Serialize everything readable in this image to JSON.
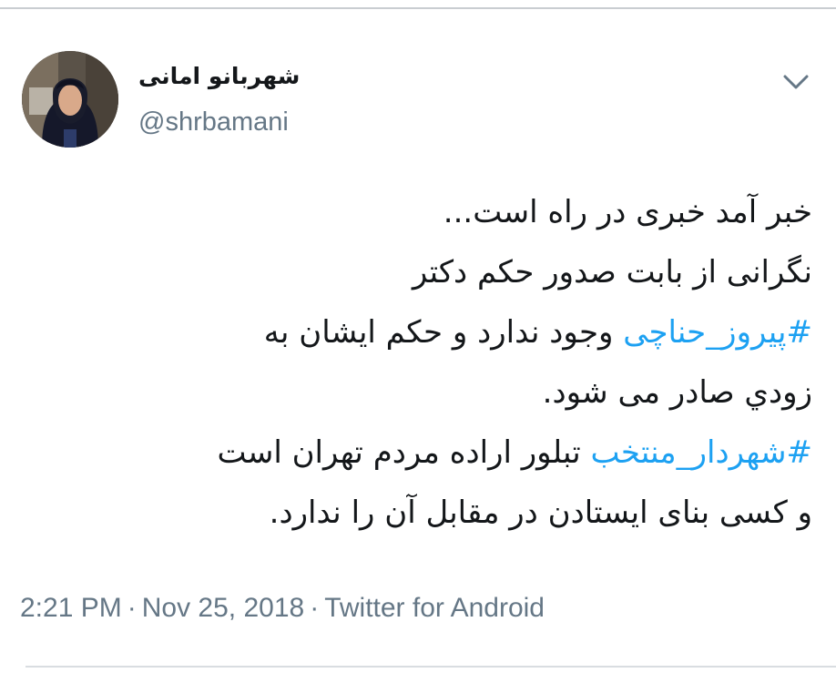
{
  "author": {
    "display_name": "شهربانو امانی",
    "handle": "@shrbamani"
  },
  "tweet": {
    "lines": [
      {
        "parts": [
          {
            "text": "خبر آمد خبری در راه است..."
          }
        ]
      },
      {
        "parts": [
          {
            "text": "نگرانی از بابت صدور حکم دکتر"
          }
        ]
      },
      {
        "parts": [
          {
            "text": "#پیروز_حناچی",
            "hashtag": true
          },
          {
            "text": " وجود ندارد و حکم ایشان به"
          }
        ]
      },
      {
        "parts": [
          {
            "text": "زودي صادر می شود."
          }
        ]
      },
      {
        "parts": [
          {
            "text": "#شهردار_منتخب",
            "hashtag": true
          },
          {
            "text": " تبلور اراده مردم تهران است"
          }
        ]
      },
      {
        "parts": [
          {
            "text": "و کسی بنای ایستادن در مقابل آن را ندارد."
          }
        ]
      }
    ]
  },
  "meta": {
    "time": "2:21 PM",
    "separator": "·",
    "date": "Nov 25, 2018",
    "source": "Twitter for Android"
  },
  "icons": {
    "menu": "chevron-down-icon"
  },
  "colors": {
    "hashtag": "#1da1f2",
    "secondary_text": "#657786",
    "primary_text": "#14171a"
  }
}
